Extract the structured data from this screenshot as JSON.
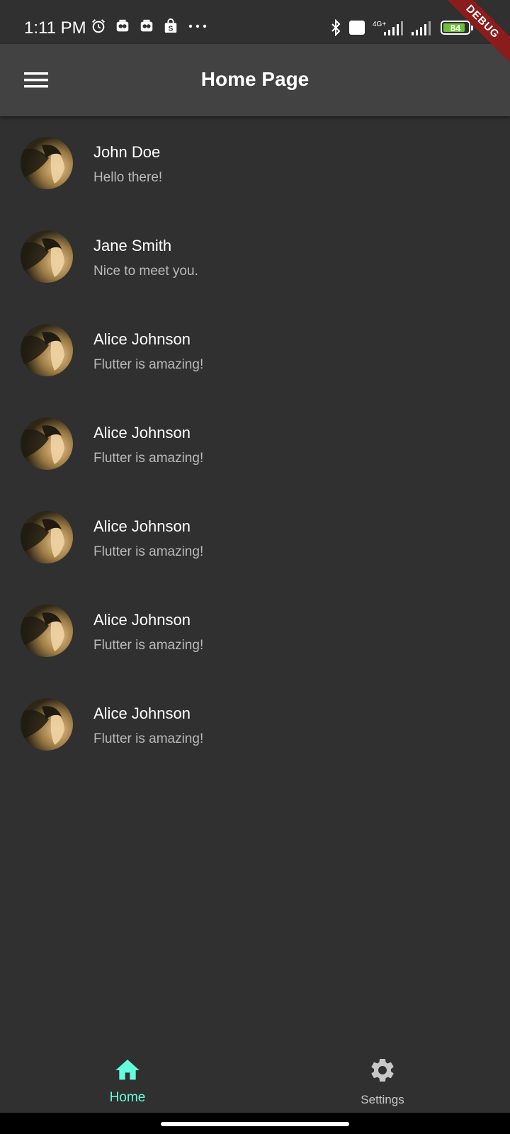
{
  "status_bar": {
    "time": "1:11 PM",
    "left_icons": [
      "alarm-icon",
      "app-notification-icon",
      "app-notification-icon",
      "shopping-bag-icon",
      "more-dots-icon"
    ],
    "right_icons": [
      "bluetooth-icon",
      "volte-icon",
      "signal-4g-icon",
      "signal-icon",
      "battery-icon"
    ],
    "network_type": "4G+",
    "volte_label": "Vo LTE",
    "battery_level": "84",
    "battery_color": "#6fbf3a"
  },
  "debug_banner": "DEBUG",
  "app_bar": {
    "title": "Home Page",
    "menu_icon": "menu-icon",
    "background": "#424242"
  },
  "contacts": [
    {
      "name": "John Doe",
      "message": "Hello there!"
    },
    {
      "name": "Jane Smith",
      "message": "Nice to meet you."
    },
    {
      "name": "Alice Johnson",
      "message": "Flutter is amazing!"
    },
    {
      "name": "Alice Johnson",
      "message": "Flutter is amazing!"
    },
    {
      "name": "Alice Johnson",
      "message": "Flutter is amazing!"
    },
    {
      "name": "Alice Johnson",
      "message": "Flutter is amazing!"
    },
    {
      "name": "Alice Johnson",
      "message": "Flutter is amazing!"
    }
  ],
  "bottom_nav": {
    "items": [
      {
        "label": "Home",
        "icon": "home-icon",
        "selected": true
      },
      {
        "label": "Settings",
        "icon": "settings-gear-icon",
        "selected": false
      }
    ],
    "selected_color": "#64ffda",
    "unselected_color": "#c8c8c8"
  },
  "colors": {
    "background": "#303030",
    "app_bar": "#424242",
    "title_text": "#ffffff",
    "subtitle_text": "#b9b9b9"
  }
}
